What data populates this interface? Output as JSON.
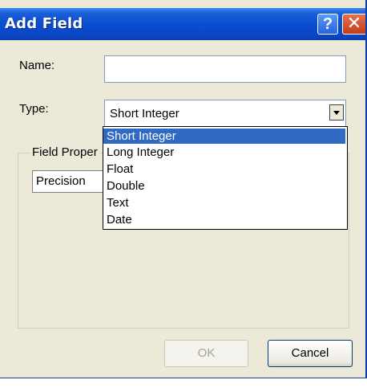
{
  "window": {
    "title": "Add Field",
    "help_glyph": "?",
    "close_glyph": "✕"
  },
  "form": {
    "name_label": "Name:",
    "name_value": "",
    "type_label": "Type:",
    "type_selected": "Short Integer"
  },
  "dropdown": {
    "options": [
      "Short Integer",
      "Long Integer",
      "Float",
      "Double",
      "Text",
      "Date"
    ],
    "highlighted": "Short Integer"
  },
  "field_properties": {
    "legend": "Field Proper",
    "property_label": "Precision"
  },
  "buttons": {
    "ok_label": "OK",
    "cancel_label": "Cancel"
  },
  "colors": {
    "title_bar": "#0a4dd0",
    "selection": "#316ac5",
    "dialog_face": "#ece9d8",
    "close_button": "#c33d19"
  }
}
